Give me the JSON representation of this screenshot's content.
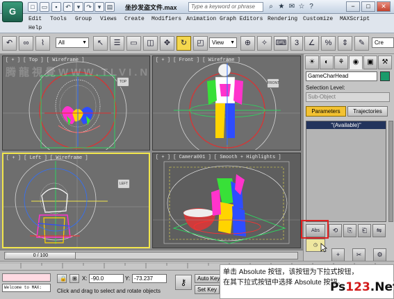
{
  "app": {
    "logo": "G",
    "title": "坐抄发盗文件.max",
    "search_placeholder": "Type a keyword or phrase"
  },
  "menu": [
    "Edit",
    "Tools",
    "Group",
    "Views",
    "Create",
    "Modifiers",
    "Animation",
    "Graph Editors",
    "Rendering",
    "Customize",
    "MAXScript",
    "Help"
  ],
  "toolbar": {
    "filter_value": "All",
    "coord_system": "View",
    "snap_label": "3",
    "named_sel_placeholder": "Cre"
  },
  "viewports": {
    "top": "[ + ] [ Top ] [ Wireframe ]",
    "front": "[ + ] [ Front ] [ Wireframe ]",
    "left": "[ + ] [ Left ] [ Wireframe ]",
    "camera": "[ + ] [ Camera001 ] [ Smooth + Highlights ]",
    "cube_top": "TOP",
    "cube_front": "FRONT",
    "cube_left": "LEFT",
    "watermark": "腾龍視覺WWW.TLVI.NET"
  },
  "command_panel": {
    "object_name": "GameCharHead",
    "selection_level_label": "Selection Level:",
    "sub_object_value": "Sub-Object",
    "parameters_label": "Parameters",
    "trajectories_label": "Trajectories",
    "available_label": "\"(Available)\"",
    "absolute_label": "Abs"
  },
  "timeline": {
    "frame_label": "0 / 100"
  },
  "status": {
    "listener_text": "Welcome to MAX:",
    "x_label": "X:",
    "x_value": "-90.0",
    "y_label": "Y:",
    "y_value": "-73.237",
    "auto_key_label": "Auto Key",
    "set_key_label": "Set Key",
    "prompt": "Click and drag to select and rotate objects"
  },
  "caption": {
    "line1": "单击 Absolute 按钮，该按钮为下拉式按钮，",
    "line2": "在其下拉式按钮中选择 Absolute 按钮。"
  },
  "watermark_logo": {
    "left": "Ps",
    "mid": "123",
    "right": ".Net"
  },
  "colors": {
    "active_viewport_border": "#f2e64c",
    "parameters_active": "#f3c232",
    "object_color": "#1a9b6b",
    "highlight": "#e02020"
  }
}
